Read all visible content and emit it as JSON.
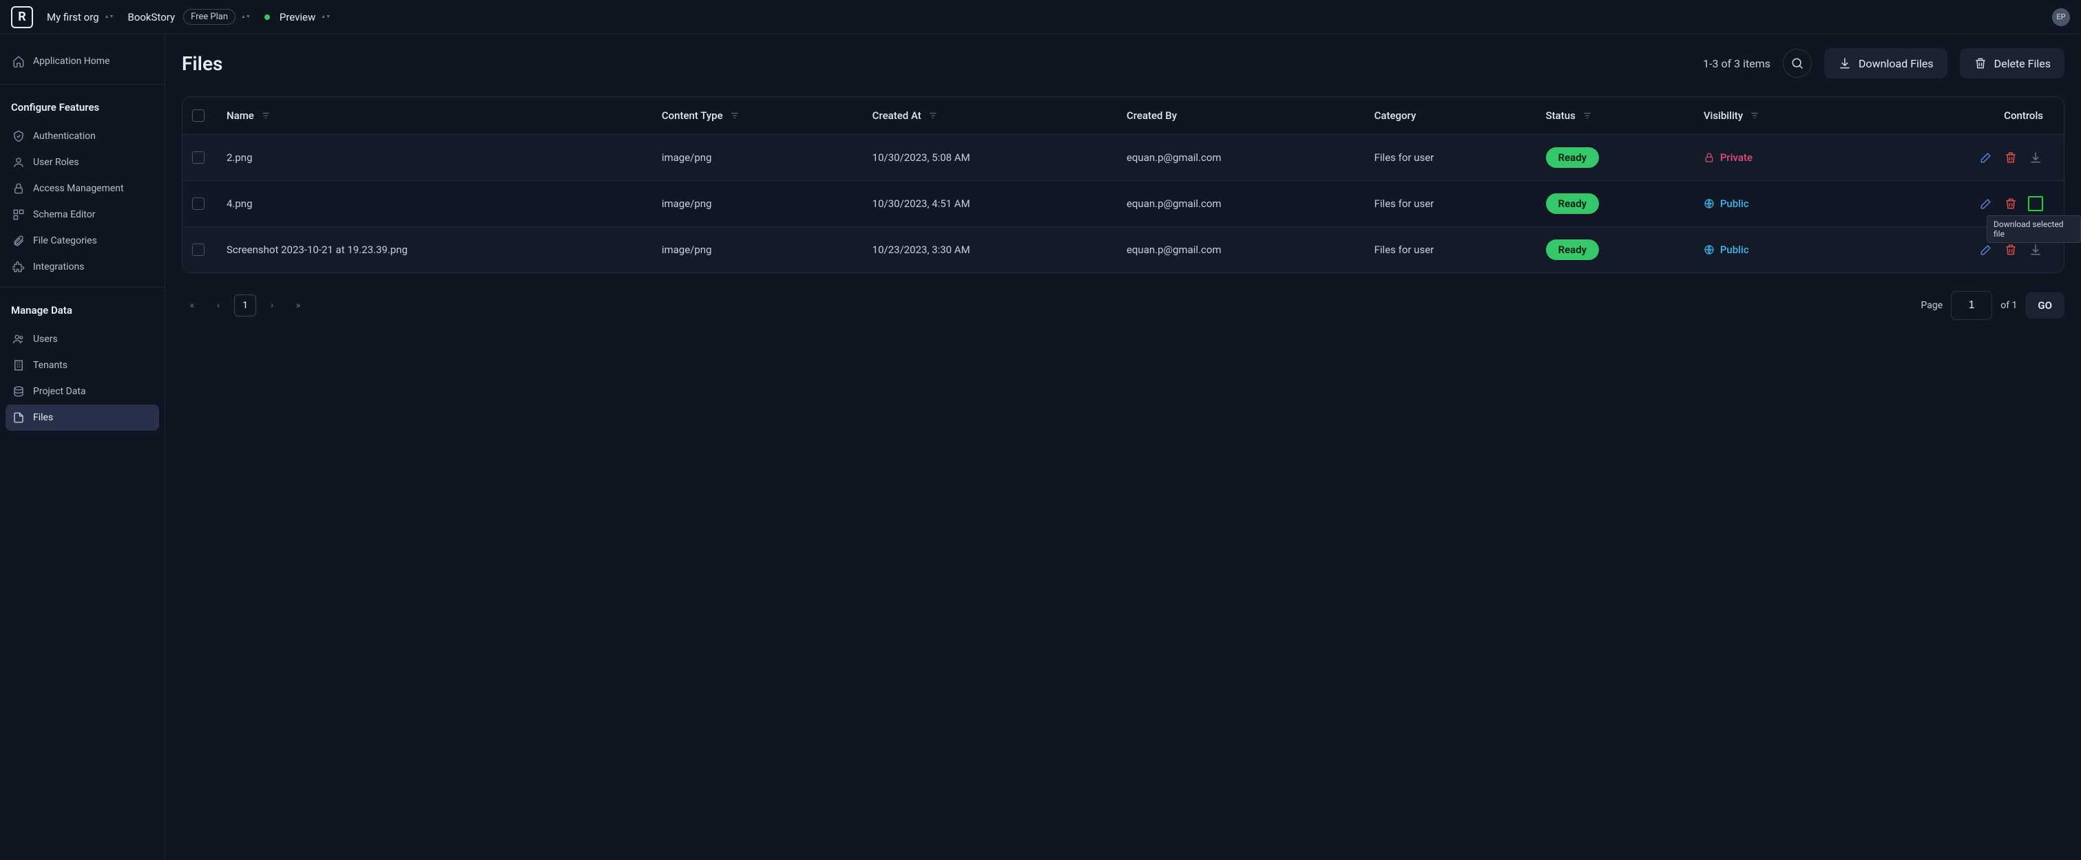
{
  "topbar": {
    "org_name": "My first org",
    "project_name": "BookStory",
    "plan_badge": "Free Plan",
    "environment": "Preview",
    "user_initials": "EP"
  },
  "sidebar": {
    "home_label": "Application Home",
    "sections": [
      {
        "title": "Configure Features",
        "items": [
          {
            "label": "Authentication",
            "icon": "shield"
          },
          {
            "label": "User Roles",
            "icon": "user"
          },
          {
            "label": "Access Management",
            "icon": "lock"
          },
          {
            "label": "Schema Editor",
            "icon": "layout"
          },
          {
            "label": "File Categories",
            "icon": "paperclip"
          },
          {
            "label": "Integrations",
            "icon": "puzzle"
          }
        ]
      },
      {
        "title": "Manage Data",
        "items": [
          {
            "label": "Users",
            "icon": "users"
          },
          {
            "label": "Tenants",
            "icon": "building"
          },
          {
            "label": "Project Data",
            "icon": "database"
          },
          {
            "label": "Files",
            "icon": "file",
            "active": true
          }
        ]
      }
    ]
  },
  "page": {
    "title": "Files",
    "count_text": "1-3 of 3 items",
    "download_btn": "Download Files",
    "delete_btn": "Delete Files"
  },
  "table": {
    "headers": {
      "name": "Name",
      "content_type": "Content Type",
      "created_at": "Created At",
      "created_by": "Created By",
      "category": "Category",
      "status": "Status",
      "visibility": "Visibility",
      "controls": "Controls"
    },
    "rows": [
      {
        "name": "2.png",
        "content_type": "image/png",
        "created_at": "10/30/2023, 5:08 AM",
        "created_by": "equan.p@gmail.com",
        "category": "Files for user",
        "status": "Ready",
        "visibility": "Private"
      },
      {
        "name": "4.png",
        "content_type": "image/png",
        "created_at": "10/30/2023, 4:51 AM",
        "created_by": "equan.p@gmail.com",
        "category": "Files for user",
        "status": "Ready",
        "visibility": "Public",
        "download_highlight": true
      },
      {
        "name": "Screenshot 2023-10-21 at 19.23.39.png",
        "content_type": "image/png",
        "created_at": "10/23/2023, 3:30 AM",
        "created_by": "equan.p@gmail.com",
        "category": "Files for user",
        "status": "Ready",
        "visibility": "Public"
      }
    ]
  },
  "pagination": {
    "current_page": "1",
    "page_label": "Page",
    "page_input_value": "1",
    "of_label": "of 1",
    "go": "GO"
  },
  "tooltip": {
    "text": "Download selected file"
  }
}
